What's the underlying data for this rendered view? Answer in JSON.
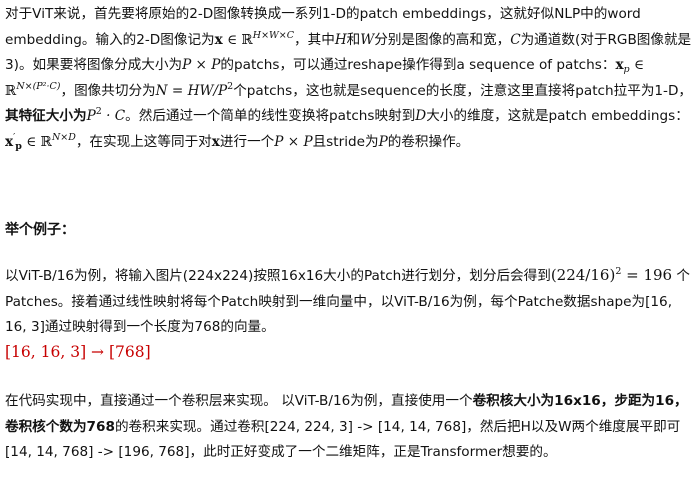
{
  "intro": {
    "t1": "对于ViT来说，首先要将原始的2-D图像转换成一系列1-D的patch embeddings，这就好似NLP中的word embedding。输入的2-D图像记为",
    "m_x": "x",
    "m_in": " ∈ ℝ",
    "m_hwc": "H×W×C",
    "t2": "，其中",
    "m_H": "H",
    "t3": "和",
    "m_W": "W",
    "t4": "分别是图像的高和宽，",
    "m_C": "C",
    "t5": "为通道数(对于RGB图像就是3)。如果要将图像分成大小为",
    "m_PxP": "P × P",
    "t6": "的patchs，可以通过reshape操作得到a sequence of patchs：",
    "m_xp": "x",
    "m_p_sub": "p",
    "m_in2": " ∈ ℝ",
    "m_np2c": "N×(P²·C)",
    "t7": "，图像共切分为",
    "m_N_eq": "N = HW/P",
    "m_two": "2",
    "t8": "个patchs，这也就是sequence的长度，注意这里直接将patch拉平为1-D，",
    "t9_bold": "其特征大小为",
    "m_P2C": "P",
    "m_two_b": "2",
    "m_dotC": " · C",
    "t10": "。然后通过一个简单的线性变换将patchs映射到",
    "m_D": "D",
    "t11": "大小的维度，这就是patch embeddings：",
    "m_xpprime": "x",
    "m_prime": "′",
    "m_p_sub2": "p",
    "m_in3": " ∈ ℝ",
    "m_nd": "N×D",
    "t12": "，在实现上这等同于对",
    "m_x2": "x",
    "t13": "进行一个",
    "m_PxP2": "P × P",
    "t14": "且stride为",
    "m_P": "P",
    "t15": "的卷积操作。"
  },
  "example": {
    "heading": "举个例子：",
    "p1": "以ViT-B/16为例，将输入图片(224x224)按照16x16大小的Patch进行划分，划分后会得到",
    "m_calc": "(224/16)",
    "m_sq": "2",
    "m_eq": " = 196",
    "p2": " 个Patches。接着通过线性映射将每个Patch映射到一维向量中，以ViT-B/16为例，每个Patche数据shape为[16, 16, 3]通过映射得到一个长度为768的向量。",
    "formula": "[16, 16, 3] → [768]"
  },
  "impl": {
    "t1": "在代码实现中，直接通过一个卷积层来实现。 以ViT-B/16为例，直接使用一个",
    "b1": "卷积核大小为16x16，步距为16，卷积核个数为768",
    "t2": "的卷积来实现。通过卷积[224, 224, 3] -> [14, 14, 768]，然后把H以及W两个维度展平即可[14, 14, 768] -> [196, 768]，此时正好变成了一个二维矩阵，正是Transformer想要的。"
  },
  "colors": {
    "text": "#121212",
    "formula_red": "#c70000"
  }
}
